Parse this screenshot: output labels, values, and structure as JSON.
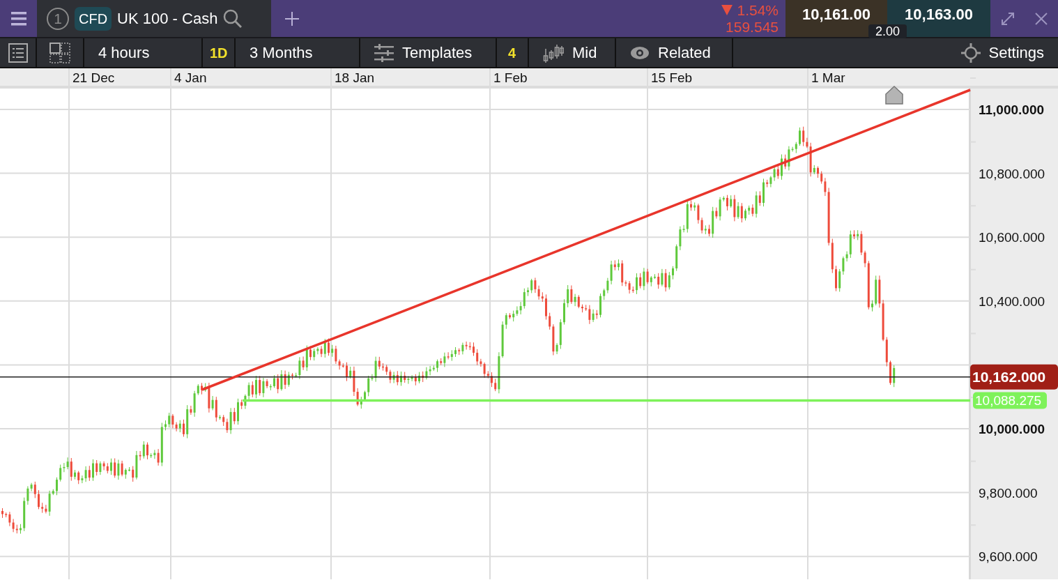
{
  "top_bar": {
    "window_number": "1",
    "instrument_type": "CFD",
    "instrument_name": "UK 100 - Cash",
    "falling": true,
    "change_percent": "1.54%",
    "change_points": "159.545",
    "sell_price": "10,161.00",
    "buy_price": "10,163.00",
    "spread": "2.00"
  },
  "toolbar": {
    "interval": "4 hours",
    "period_badge": "1D",
    "range": "3 Months",
    "templates": "Templates",
    "templates_count": "4",
    "price_type": "Mid",
    "related": "Related",
    "settings": "Settings"
  },
  "chart": {
    "x_labels": [
      "21 Dec",
      "4 Jan",
      "18 Jan",
      "1 Feb",
      "15 Feb",
      "1 Mar"
    ],
    "y_labels": [
      {
        "label": "11,000.000",
        "bold": true
      },
      {
        "label": "10,800.000",
        "bold": false
      },
      {
        "label": "10,600.000",
        "bold": false
      },
      {
        "label": "10,400.000",
        "bold": false
      },
      {
        "label": "10,000.000",
        "bold": true
      },
      {
        "label": "9,800.000",
        "bold": false
      },
      {
        "label": "9,600.000",
        "bold": false
      }
    ],
    "price_markers": [
      {
        "label": "10,162.000",
        "kind": "current"
      },
      {
        "label": "10,088.275",
        "kind": "support"
      }
    ]
  }
}
